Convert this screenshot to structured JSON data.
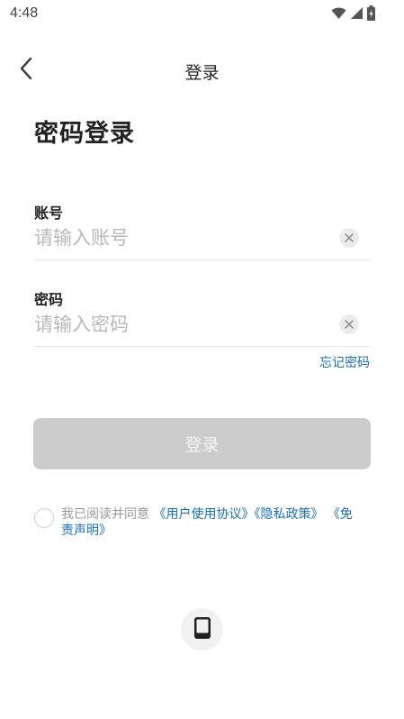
{
  "status_bar": {
    "time": "4:48"
  },
  "nav": {
    "title": "登录"
  },
  "page_title": "密码登录",
  "account": {
    "label": "账号",
    "value": "",
    "placeholder": "请输入账号"
  },
  "password": {
    "label": "密码",
    "value": "",
    "placeholder": "请输入密码"
  },
  "forgot_password": "忘记密码",
  "login_button": "登录",
  "agreement": {
    "prefix": "我已阅读并同意",
    "user_agreement": "《用户使用协议》",
    "privacy_policy": "《隐私政策》",
    "disclaimer": "《免责声明》",
    "checked": false
  },
  "colors": {
    "link": "#1a6fb8",
    "button_disabled": "#cccccc",
    "placeholder": "#b8b8b8"
  },
  "icons": {
    "back": "chevron-left-icon",
    "clear": "close-icon",
    "device": "tablet-icon",
    "wifi": "wifi-icon",
    "signal": "signal-icon",
    "battery": "battery-icon"
  }
}
